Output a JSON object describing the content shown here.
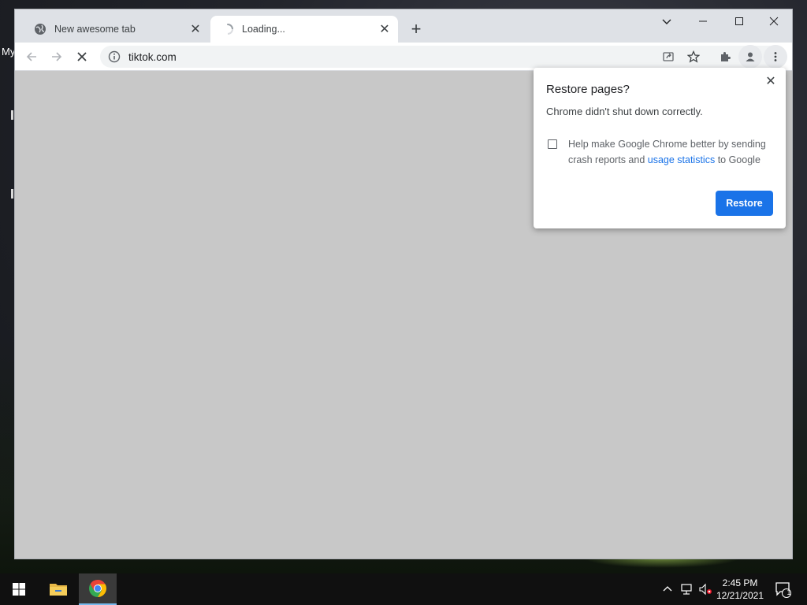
{
  "desktop": {
    "label": "My"
  },
  "browser": {
    "tabs": [
      {
        "title": "New awesome tab",
        "favicon": "globe-icon",
        "active": false
      },
      {
        "title": "Loading...",
        "favicon": "spinner-icon",
        "active": true
      }
    ],
    "omnibox": {
      "url": "tiktok.com"
    }
  },
  "restore_bubble": {
    "title": "Restore pages?",
    "message": "Chrome didn't shut down correctly.",
    "checkbox_text_before": "Help make Google Chrome better by sending crash reports and ",
    "checkbox_link": "usage statistics",
    "checkbox_text_after": " to Google",
    "checkbox_checked": false,
    "restore_label": "Restore"
  },
  "taskbar": {
    "time": "2:45 PM",
    "date": "12/21/2021",
    "notification_count": "1"
  },
  "colors": {
    "accent": "#1a73e8",
    "content_bg": "#c8c8c8",
    "tabstrip_bg": "#dee1e6"
  }
}
